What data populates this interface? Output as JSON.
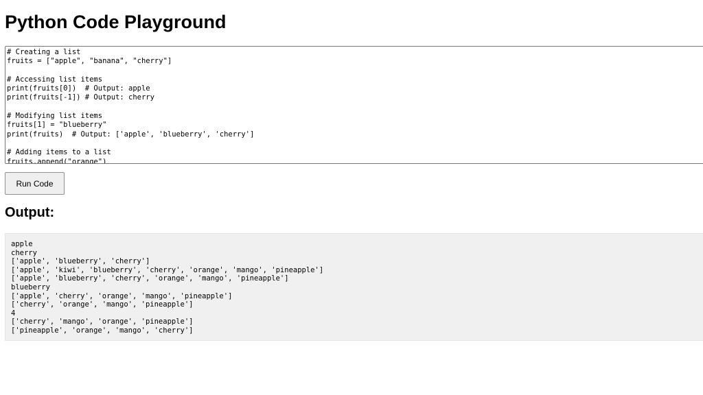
{
  "page": {
    "title": "Python Code Playground"
  },
  "editor": {
    "code": "# Creating a list\nfruits = [\"apple\", \"banana\", \"cherry\"]\n\n# Accessing list items\nprint(fruits[0])  # Output: apple\nprint(fruits[-1]) # Output: cherry\n\n# Modifying list items\nfruits[1] = \"blueberry\"\nprint(fruits)  # Output: ['apple', 'blueberry', 'cherry']\n\n# Adding items to a list\nfruits.append(\"orange\")"
  },
  "controls": {
    "run_label": "Run Code"
  },
  "output": {
    "heading": "Output:",
    "text": "apple\ncherry\n['apple', 'blueberry', 'cherry']\n['apple', 'kiwi', 'blueberry', 'cherry', 'orange', 'mango', 'pineapple']\n['apple', 'blueberry', 'cherry', 'orange', 'mango', 'pineapple']\nblueberry\n['apple', 'cherry', 'orange', 'mango', 'pineapple']\n['cherry', 'orange', 'mango', 'pineapple']\n4\n['cherry', 'mango', 'orange', 'pineapple']\n['pineapple', 'orange', 'mango', 'cherry']"
  },
  "colors": {
    "background": "#ffffff",
    "output_background": "#f0f0f0",
    "button_background": "#efefef",
    "editor_border": "#767676"
  }
}
